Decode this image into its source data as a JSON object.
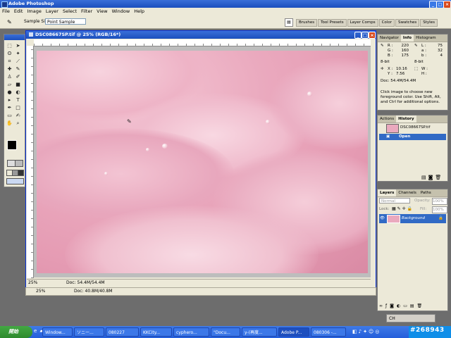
{
  "app": {
    "title": "Adobe Photoshop"
  },
  "menu": [
    "File",
    "Edit",
    "Image",
    "Layer",
    "Select",
    "Filter",
    "View",
    "Window",
    "Help"
  ],
  "options": {
    "sample_size_label": "Sample Size:",
    "sample_size_value": "Point Sample"
  },
  "palette_well": [
    "Brushes",
    "Tool Presets",
    "Layer Comps",
    "Color",
    "Swatches",
    "Styles"
  ],
  "document": {
    "title": "DSC08667SP.tif @ 25% (RGB/16*)",
    "zoom": "25%",
    "doc_size": "Doc: 54.4M/54.4M"
  },
  "document2": {
    "zoom": "25%",
    "doc_size": "Doc: 40.8M/40.8M"
  },
  "info_panel": {
    "tabs": [
      "Navigator",
      "Info",
      "Histogram"
    ],
    "rgb_labels": [
      "R :",
      "G :",
      "B :"
    ],
    "rgb_values": [
      "220",
      "160",
      "175"
    ],
    "lab_labels": [
      "L :",
      "a :",
      "b :"
    ],
    "lab_values": [
      "75",
      "32",
      "4"
    ],
    "bit_left": "8-bit",
    "bit_right": "8-bit",
    "x_label": "X :",
    "x_value": "10.16",
    "y_label": "Y :",
    "y_value": "7.56",
    "w_label": "W :",
    "h_label": "H :",
    "doc_size": "Doc: 54.4M/54.4M",
    "hint": "Click image to choose new foreground color.  Use Shift, Alt, and Ctrl for additional options."
  },
  "history_panel": {
    "tabs": [
      "Actions",
      "History"
    ],
    "snapshot": "DSC08667SP.tif",
    "state": "Open"
  },
  "layers_panel": {
    "tabs": [
      "Layers",
      "Channels",
      "Paths"
    ],
    "blend_mode": "Normal",
    "opacity_label": "Opacity:",
    "opacity_value": "100%",
    "lock_label": "Lock:",
    "fill_label": "Fill:",
    "fill_value": "100%",
    "layer_name": "Background"
  },
  "language_bar": {
    "label": "CH"
  },
  "taskbar": {
    "start": "開始",
    "items": [
      "Window...",
      "ソニー...",
      "080227",
      "KKCity...",
      "cyphero...",
      "\"Docu...",
      "y-(再度...",
      "Adobe P...",
      "080306 -..."
    ]
  },
  "watermark": "#268943",
  "colors": {
    "title_blue": "#245edb",
    "selection_blue": "#316ac5",
    "photo_pink": "#eaa9be"
  }
}
